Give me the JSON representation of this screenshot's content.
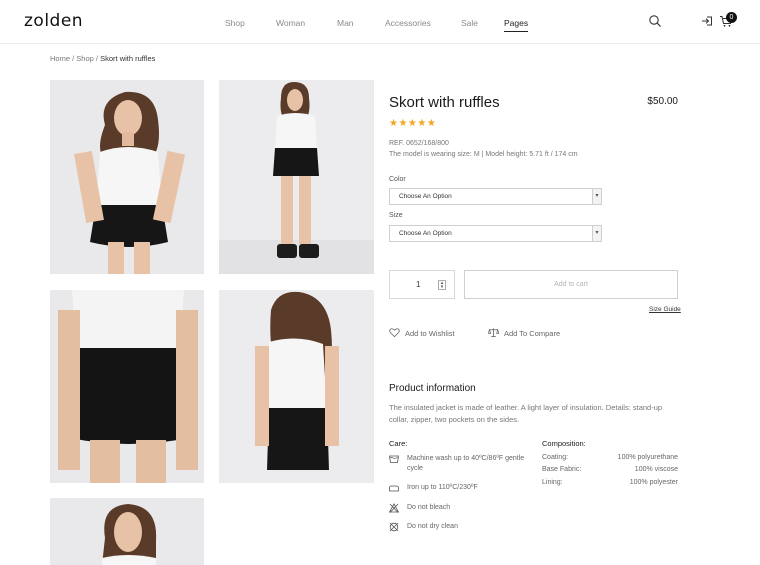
{
  "header": {
    "logo": "zolden",
    "nav": [
      "Shop",
      "Woman",
      "Man",
      "Accessories",
      "Sale",
      "Pages"
    ],
    "active_nav": "Pages",
    "cart_count": "0"
  },
  "breadcrumb": {
    "home": "Home",
    "shop": "Shop",
    "current": "Skort with ruffles",
    "separator": "/"
  },
  "product": {
    "title": "Skort with ruffles",
    "price": "$50.00",
    "rating": 5,
    "stars": "★★★★★",
    "star_color": "#f2a623",
    "ref": "REF. 0652/168/800",
    "model_info": "The model is wearing size: M | Model height: 5.71 ft / 174 cm"
  },
  "options": {
    "color_label": "Color",
    "color_value": "Choose An Option",
    "size_label": "Size",
    "size_value": "Choose An Option"
  },
  "cart": {
    "quantity": "1",
    "add_to_cart": "Add to cart",
    "size_guide": "Size Guide"
  },
  "actions": {
    "wishlist": "Add to Wishlist",
    "compare": "Add To Compare"
  },
  "info": {
    "title": "Product information",
    "description": "The insulated jacket is made of leather. A light layer of insulation. Details: stand-up collar, zipper, two pockets on the sides."
  },
  "care": {
    "title": "Care:",
    "items": [
      {
        "icon": "wash-icon",
        "text": "Machine wash up to 40ºC/86ºF gentle cycle"
      },
      {
        "icon": "iron-icon",
        "text": "Iron up to 110ºC/230ºF"
      },
      {
        "icon": "no-bleach-icon",
        "text": "Do not bleach"
      },
      {
        "icon": "no-dry-clean-icon",
        "text": "Do not dry clean"
      }
    ]
  },
  "composition": {
    "title": "Composition:",
    "rows": [
      {
        "key": "Coating:",
        "value": "100% polyurethane"
      },
      {
        "key": "Base Fabric:",
        "value": "100% viscose"
      },
      {
        "key": "Lining:",
        "value": "100% polyester"
      }
    ]
  }
}
